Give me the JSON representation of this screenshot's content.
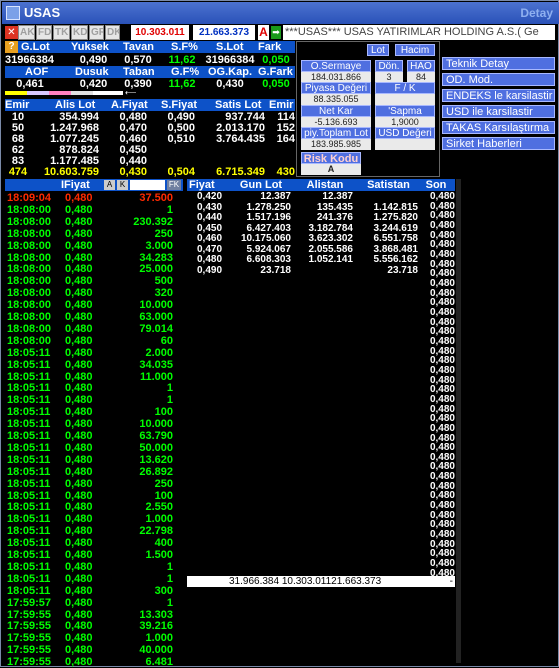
{
  "window": {
    "title": "USAS",
    "detail_label": "Detay"
  },
  "toolbar": {
    "buttons": [
      "AK",
      "FD",
      "TK",
      "KD",
      "GR",
      "DK"
    ],
    "value1": "10.303.011",
    "value2": "21.663.373",
    "a_label": "A",
    "marquee": "***USAS*** USAS YATIRIMLAR HOLDING A.S.( Ge"
  },
  "summary": {
    "row1_headers": [
      "G.Lot",
      "Yuksek",
      "Tavan",
      "S.F%",
      "S.Lot",
      "Fark"
    ],
    "row1_values": [
      "31966384",
      "0,490",
      "0,570",
      "11,62",
      "31966384",
      "0,050"
    ],
    "row2_headers": [
      "AOF",
      "Dusuk",
      "Taban",
      "G.F%",
      "OG.Kap.",
      "G.Fark"
    ],
    "row2_values": [
      "0,461",
      "0,420",
      "0,390",
      "11,62",
      "0,430",
      "0,050"
    ]
  },
  "panel": {
    "lot_btn": "Lot",
    "hacim_btn": "Hacim",
    "o_sermaye": "O.Sermaye",
    "o_sermaye_val": "184.031.866",
    "don": "Dön.",
    "don_val": "3",
    "hao": "HAO",
    "hao_val": "84",
    "piyasa": "Piyasa Değeri",
    "piyasa_val": "88.335.055",
    "fk": "F / K",
    "fk_val": "",
    "netkar": "Net Kar",
    "netkar_val": "-5.136.693",
    "sapma": "'Sapma",
    "sapma_val": "1,9000",
    "toplam": "piy.Toplam Lot",
    "toplam_val": "183.985.985",
    "usd": "USD Değeri",
    "usd_val": "",
    "risk": "Risk Kodu",
    "risk_val": "A"
  },
  "side_menu": [
    "Teknik Detay",
    "OD. Mod.",
    "ENDEKS le karsilastir",
    "USD ile karsilastir",
    "TAKAS Karsılaştırma",
    "Sirket Haberleri"
  ],
  "depth": {
    "headers": [
      "Emir",
      "Alis Lot",
      "A.Fiyat",
      "S.Fiyat",
      "Satis Lot",
      "Emir"
    ],
    "rows": [
      [
        "10",
        "354.994",
        "0,480",
        "0,490",
        "937.744",
        "114"
      ],
      [
        "50",
        "1.247.968",
        "0,470",
        "0,500",
        "2.013.170",
        "152"
      ],
      [
        "68",
        "1.077.245",
        "0,460",
        "0,510",
        "3.764.435",
        "164"
      ],
      [
        "62",
        "878.824",
        "0,450",
        "",
        "",
        " "
      ],
      [
        "83",
        "1.177.485",
        "0,440",
        "",
        "",
        " "
      ]
    ],
    "totals": [
      "474",
      "10.603.759",
      "0,430",
      "0,504",
      "6.715.349",
      "430"
    ]
  },
  "trades": {
    "headers": [
      "IFiyat",
      "A",
      "K",
      "FK"
    ],
    "rows": [
      [
        "18:09:04",
        "0,480",
        "37.500"
      ],
      [
        "18:08:00",
        "0,480",
        "1"
      ],
      [
        "18:08:00",
        "0,480",
        "230.392"
      ],
      [
        "18:08:00",
        "0,480",
        "250"
      ],
      [
        "18:08:00",
        "0,480",
        "3.000"
      ],
      [
        "18:08:00",
        "0,480",
        "34.283"
      ],
      [
        "18:08:00",
        "0,480",
        "25.000"
      ],
      [
        "18:08:00",
        "0,480",
        "500"
      ],
      [
        "18:08:00",
        "0,480",
        "320"
      ],
      [
        "18:08:00",
        "0,480",
        "10.000"
      ],
      [
        "18:08:00",
        "0,480",
        "63.000"
      ],
      [
        "18:08:00",
        "0,480",
        "79.014"
      ],
      [
        "18:08:00",
        "0,480",
        "60"
      ],
      [
        "18:05:11",
        "0,480",
        "2.000"
      ],
      [
        "18:05:11",
        "0,480",
        "34.035"
      ],
      [
        "18:05:11",
        "0,480",
        "11.000"
      ],
      [
        "18:05:11",
        "0,480",
        "1"
      ],
      [
        "18:05:11",
        "0,480",
        "1"
      ],
      [
        "18:05:11",
        "0,480",
        "100"
      ],
      [
        "18:05:11",
        "0,480",
        "10.000"
      ],
      [
        "18:05:11",
        "0,480",
        "63.790"
      ],
      [
        "18:05:11",
        "0,480",
        "50.000"
      ],
      [
        "18:05:11",
        "0,480",
        "13.620"
      ],
      [
        "18:05:11",
        "0,480",
        "26.892"
      ],
      [
        "18:05:11",
        "0,480",
        "250"
      ],
      [
        "18:05:11",
        "0,480",
        "100"
      ],
      [
        "18:05:11",
        "0,480",
        "2.550"
      ],
      [
        "18:05:11",
        "0,480",
        "1.000"
      ],
      [
        "18:05:11",
        "0,480",
        "22.798"
      ],
      [
        "18:05:11",
        "0,480",
        "400"
      ],
      [
        "18:05:11",
        "0,480",
        "1.500"
      ],
      [
        "18:05:11",
        "0,480",
        "1"
      ],
      [
        "18:05:11",
        "0,480",
        "1"
      ],
      [
        "18:05:11",
        "0,480",
        "300"
      ],
      [
        "17:59:57",
        "0,480",
        "1"
      ],
      [
        "17:59:55",
        "0,480",
        "13.303"
      ],
      [
        "17:59:55",
        "0,480",
        "39.216"
      ],
      [
        "17:59:55",
        "0,480",
        "1.000"
      ],
      [
        "17:59:55",
        "0,480",
        "40.000"
      ],
      [
        "17:59:55",
        "0,480",
        "6.481"
      ]
    ]
  },
  "price_dist": {
    "headers": [
      "Fiyat",
      "Gun Lot",
      "Alistan",
      "Satistan",
      "Son"
    ],
    "rows": [
      [
        "0,420",
        "12.387",
        "12.387",
        ""
      ],
      [
        "0,430",
        "1.278.250",
        "135.435",
        "1.142.815"
      ],
      [
        "0,440",
        "1.517.196",
        "241.376",
        "1.275.820"
      ],
      [
        "0,450",
        "6.427.403",
        "3.182.784",
        "3.244.619"
      ],
      [
        "0,460",
        "10.175.060",
        "3.623.302",
        "6.551.758"
      ],
      [
        "0,470",
        "5.924.067",
        "2.055.586",
        "3.868.481"
      ],
      [
        "0,480",
        "6.608.303",
        "1.052.141",
        "5.556.162"
      ],
      [
        "0,490",
        "23.718",
        "",
        "23.718"
      ]
    ],
    "totals": "31.966.384 10.303.01121.663.373",
    "total_dash": "-",
    "son_values": [
      "0,480",
      "0,480",
      "0,480",
      "0,480",
      "0,480",
      "0,480",
      "0,480",
      "0,480",
      "0,480",
      "0,480",
      "0,480",
      "0,480",
      "0,480",
      "0,480",
      "0,480",
      "0,480",
      "0,480",
      "0,480",
      "0,480",
      "0,480",
      "0,480",
      "0,480",
      "0,480",
      "0,480",
      "0,480",
      "0,480",
      "0,480",
      "0,480",
      "0,480",
      "0,480",
      "0,480",
      "0,480",
      "0,480",
      "0,480",
      "0,480",
      "0,480",
      "0,480",
      "0,480",
      "0,480",
      "0,480"
    ]
  },
  "colors": {
    "accent": "#0d52c8",
    "positive": "#00ff00",
    "negative": "#ff2a00",
    "highlight": "#ffff00"
  }
}
